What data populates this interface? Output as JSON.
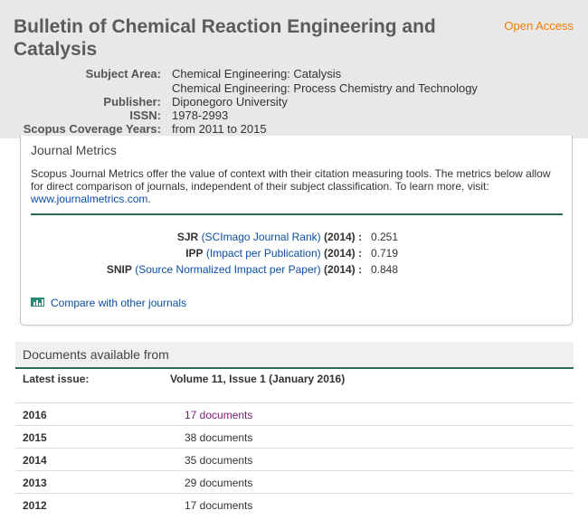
{
  "header": {
    "title": "Bulletin of Chemical Reaction Engineering and Catalysis",
    "open_access": "Open Access",
    "subject_area_label": "Subject Area:",
    "subject_areas": [
      "Chemical Engineering: Catalysis",
      "Chemical Engineering: Process Chemistry and Technology"
    ],
    "publisher_label": "Publisher:",
    "publisher": "Diponegoro University",
    "issn_label": "ISSN:",
    "issn": "1978-2993",
    "coverage_label": "Scopus Coverage Years:",
    "coverage": "from 2011 to 2015"
  },
  "metrics": {
    "title": "Journal Metrics",
    "description": "Scopus Journal Metrics offer the value of context with their citation measuring tools. The metrics below allow for direct comparison of journals, independent of their subject classification. To learn more, visit:",
    "link": "www.journalmetrics.com",
    "link_suffix": ".",
    "rows": [
      {
        "abbr": "SJR",
        "name": "(SCImago Journal Rank)",
        "year": "(2014) :",
        "value": "0.251"
      },
      {
        "abbr": "IPP",
        "name": "(Impact per Publication)",
        "year": "(2014) :",
        "value": "0.719"
      },
      {
        "abbr": "SNIP",
        "name": "(Source Normalized Impact per Paper)",
        "year": "(2014) :",
        "value": "0.848"
      }
    ],
    "compare_label": "Compare with other journals"
  },
  "documents": {
    "title": "Documents available from",
    "latest_label": "Latest issue:",
    "latest_value": "Volume 11, Issue 1 (January 2016)",
    "years": [
      {
        "year": "2016",
        "count": "17 documents"
      },
      {
        "year": "2015",
        "count": "38 documents"
      },
      {
        "year": "2014",
        "count": "35 documents"
      },
      {
        "year": "2013",
        "count": "29 documents"
      },
      {
        "year": "2012",
        "count": "17 documents"
      }
    ]
  },
  "colors": {
    "open_access": "#f07c00",
    "link": "#0b4ea2",
    "visited_link": "#7a1a76",
    "divider": "#2a6b5b"
  }
}
